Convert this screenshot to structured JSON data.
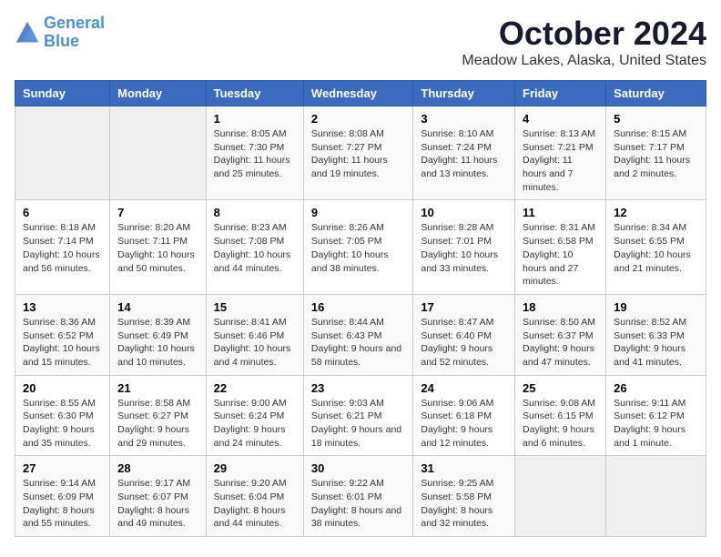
{
  "logo": {
    "line1": "General",
    "line2": "Blue"
  },
  "title": "October 2024",
  "subtitle": "Meadow Lakes, Alaska, United States",
  "days_of_week": [
    "Sunday",
    "Monday",
    "Tuesday",
    "Wednesday",
    "Thursday",
    "Friday",
    "Saturday"
  ],
  "weeks": [
    [
      {
        "num": "",
        "sunrise": "",
        "sunset": "",
        "daylight": ""
      },
      {
        "num": "",
        "sunrise": "",
        "sunset": "",
        "daylight": ""
      },
      {
        "num": "1",
        "sunrise": "Sunrise: 8:05 AM",
        "sunset": "Sunset: 7:30 PM",
        "daylight": "Daylight: 11 hours and 25 minutes."
      },
      {
        "num": "2",
        "sunrise": "Sunrise: 8:08 AM",
        "sunset": "Sunset: 7:27 PM",
        "daylight": "Daylight: 11 hours and 19 minutes."
      },
      {
        "num": "3",
        "sunrise": "Sunrise: 8:10 AM",
        "sunset": "Sunset: 7:24 PM",
        "daylight": "Daylight: 11 hours and 13 minutes."
      },
      {
        "num": "4",
        "sunrise": "Sunrise: 8:13 AM",
        "sunset": "Sunset: 7:21 PM",
        "daylight": "Daylight: 11 hours and 7 minutes."
      },
      {
        "num": "5",
        "sunrise": "Sunrise: 8:15 AM",
        "sunset": "Sunset: 7:17 PM",
        "daylight": "Daylight: 11 hours and 2 minutes."
      }
    ],
    [
      {
        "num": "6",
        "sunrise": "Sunrise: 8:18 AM",
        "sunset": "Sunset: 7:14 PM",
        "daylight": "Daylight: 10 hours and 56 minutes."
      },
      {
        "num": "7",
        "sunrise": "Sunrise: 8:20 AM",
        "sunset": "Sunset: 7:11 PM",
        "daylight": "Daylight: 10 hours and 50 minutes."
      },
      {
        "num": "8",
        "sunrise": "Sunrise: 8:23 AM",
        "sunset": "Sunset: 7:08 PM",
        "daylight": "Daylight: 10 hours and 44 minutes."
      },
      {
        "num": "9",
        "sunrise": "Sunrise: 8:26 AM",
        "sunset": "Sunset: 7:05 PM",
        "daylight": "Daylight: 10 hours and 38 minutes."
      },
      {
        "num": "10",
        "sunrise": "Sunrise: 8:28 AM",
        "sunset": "Sunset: 7:01 PM",
        "daylight": "Daylight: 10 hours and 33 minutes."
      },
      {
        "num": "11",
        "sunrise": "Sunrise: 8:31 AM",
        "sunset": "Sunset: 6:58 PM",
        "daylight": "Daylight: 10 hours and 27 minutes."
      },
      {
        "num": "12",
        "sunrise": "Sunrise: 8:34 AM",
        "sunset": "Sunset: 6:55 PM",
        "daylight": "Daylight: 10 hours and 21 minutes."
      }
    ],
    [
      {
        "num": "13",
        "sunrise": "Sunrise: 8:36 AM",
        "sunset": "Sunset: 6:52 PM",
        "daylight": "Daylight: 10 hours and 15 minutes."
      },
      {
        "num": "14",
        "sunrise": "Sunrise: 8:39 AM",
        "sunset": "Sunset: 6:49 PM",
        "daylight": "Daylight: 10 hours and 10 minutes."
      },
      {
        "num": "15",
        "sunrise": "Sunrise: 8:41 AM",
        "sunset": "Sunset: 6:46 PM",
        "daylight": "Daylight: 10 hours and 4 minutes."
      },
      {
        "num": "16",
        "sunrise": "Sunrise: 8:44 AM",
        "sunset": "Sunset: 6:43 PM",
        "daylight": "Daylight: 9 hours and 58 minutes."
      },
      {
        "num": "17",
        "sunrise": "Sunrise: 8:47 AM",
        "sunset": "Sunset: 6:40 PM",
        "daylight": "Daylight: 9 hours and 52 minutes."
      },
      {
        "num": "18",
        "sunrise": "Sunrise: 8:50 AM",
        "sunset": "Sunset: 6:37 PM",
        "daylight": "Daylight: 9 hours and 47 minutes."
      },
      {
        "num": "19",
        "sunrise": "Sunrise: 8:52 AM",
        "sunset": "Sunset: 6:33 PM",
        "daylight": "Daylight: 9 hours and 41 minutes."
      }
    ],
    [
      {
        "num": "20",
        "sunrise": "Sunrise: 8:55 AM",
        "sunset": "Sunset: 6:30 PM",
        "daylight": "Daylight: 9 hours and 35 minutes."
      },
      {
        "num": "21",
        "sunrise": "Sunrise: 8:58 AM",
        "sunset": "Sunset: 6:27 PM",
        "daylight": "Daylight: 9 hours and 29 minutes."
      },
      {
        "num": "22",
        "sunrise": "Sunrise: 9:00 AM",
        "sunset": "Sunset: 6:24 PM",
        "daylight": "Daylight: 9 hours and 24 minutes."
      },
      {
        "num": "23",
        "sunrise": "Sunrise: 9:03 AM",
        "sunset": "Sunset: 6:21 PM",
        "daylight": "Daylight: 9 hours and 18 minutes."
      },
      {
        "num": "24",
        "sunrise": "Sunrise: 9:06 AM",
        "sunset": "Sunset: 6:18 PM",
        "daylight": "Daylight: 9 hours and 12 minutes."
      },
      {
        "num": "25",
        "sunrise": "Sunrise: 9:08 AM",
        "sunset": "Sunset: 6:15 PM",
        "daylight": "Daylight: 9 hours and 6 minutes."
      },
      {
        "num": "26",
        "sunrise": "Sunrise: 9:11 AM",
        "sunset": "Sunset: 6:12 PM",
        "daylight": "Daylight: 9 hours and 1 minute."
      }
    ],
    [
      {
        "num": "27",
        "sunrise": "Sunrise: 9:14 AM",
        "sunset": "Sunset: 6:09 PM",
        "daylight": "Daylight: 8 hours and 55 minutes."
      },
      {
        "num": "28",
        "sunrise": "Sunrise: 9:17 AM",
        "sunset": "Sunset: 6:07 PM",
        "daylight": "Daylight: 8 hours and 49 minutes."
      },
      {
        "num": "29",
        "sunrise": "Sunrise: 9:20 AM",
        "sunset": "Sunset: 6:04 PM",
        "daylight": "Daylight: 8 hours and 44 minutes."
      },
      {
        "num": "30",
        "sunrise": "Sunrise: 9:22 AM",
        "sunset": "Sunset: 6:01 PM",
        "daylight": "Daylight: 8 hours and 38 minutes."
      },
      {
        "num": "31",
        "sunrise": "Sunrise: 9:25 AM",
        "sunset": "Sunset: 5:58 PM",
        "daylight": "Daylight: 8 hours and 32 minutes."
      },
      {
        "num": "",
        "sunrise": "",
        "sunset": "",
        "daylight": ""
      },
      {
        "num": "",
        "sunrise": "",
        "sunset": "",
        "daylight": ""
      }
    ]
  ]
}
